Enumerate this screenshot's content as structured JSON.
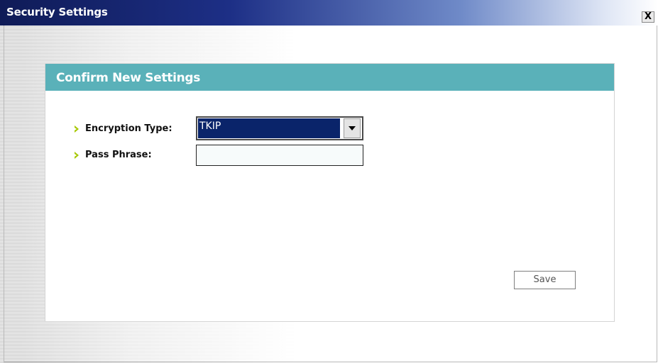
{
  "window": {
    "title": "Security Settings",
    "close_label": "X"
  },
  "panel": {
    "title": "Confirm New Settings"
  },
  "form": {
    "encryption": {
      "label": "Encryption Type:",
      "selected_value": "TKIP"
    },
    "pass_phrase": {
      "label": "Pass Phrase:",
      "value": ""
    },
    "save_label": "Save"
  },
  "colors": {
    "panel_header": "#5ab1b9",
    "arrow_icon": "#a6c800",
    "selection": "#0a246a"
  },
  "icons": {
    "bullet": "arrow-right-icon",
    "dropdown": "chevron-down-icon",
    "close": "close-icon"
  }
}
